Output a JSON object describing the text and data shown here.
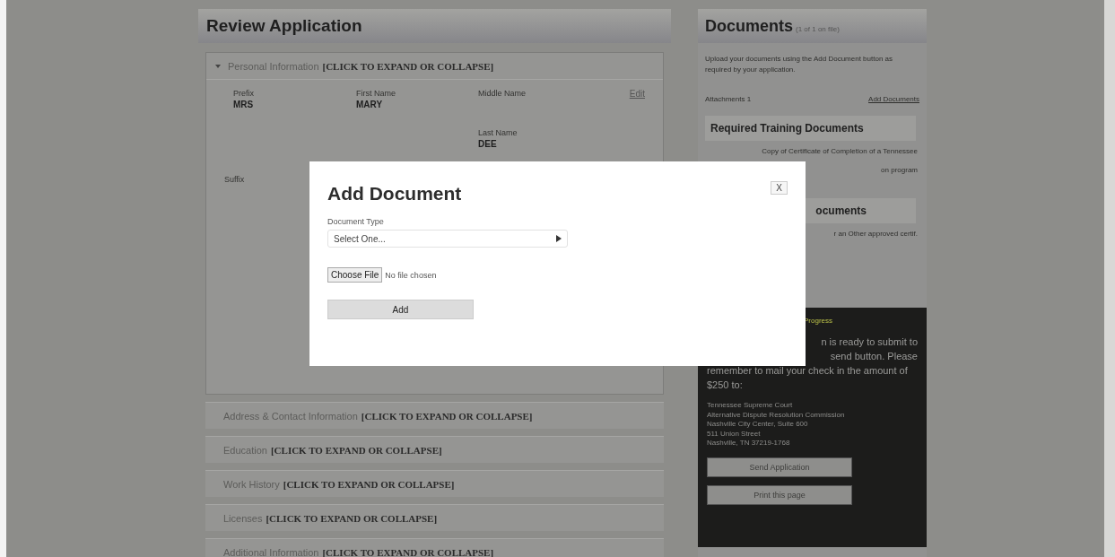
{
  "main": {
    "title": "Review Application",
    "sections": [
      {
        "title": "Personal Information",
        "action": "[CLICK TO EXPAND OR COLLAPSE]",
        "expanded": true,
        "edit": "Edit",
        "fields": [
          {
            "label": "Prefix",
            "value": "MRS"
          },
          {
            "label": "First Name",
            "value": "MARY"
          },
          {
            "label": "Middle Name"
          },
          {
            "label": "Last Name",
            "value": "DEE"
          },
          {
            "label": "Suffix"
          }
        ]
      },
      {
        "title": "Address & Contact Information",
        "action": "[CLICK TO EXPAND OR COLLAPSE]",
        "expanded": false
      },
      {
        "title": "Education",
        "action": "[CLICK TO EXPAND OR COLLAPSE]",
        "expanded": false
      },
      {
        "title": "Work History",
        "action": "[CLICK TO EXPAND OR COLLAPSE]",
        "expanded": false
      },
      {
        "title": "Licenses",
        "action": "[CLICK TO EXPAND OR COLLAPSE]",
        "expanded": false
      },
      {
        "title": "Additional Information",
        "action": "[CLICK TO EXPAND OR COLLAPSE]",
        "expanded": false
      }
    ]
  },
  "documents": {
    "title": "Documents",
    "subtitle": "(1 of 1 on file)",
    "intro": "Upload your documents using the Add Document button as required by your application.",
    "count": "Attachments 1",
    "add_link": "Add Documents",
    "groups": [
      {
        "title": "Required Training Documents",
        "lines": [
          "Copy of Certificate of Completion of a Tennessee",
          "on program"
        ]
      },
      {
        "title": "ocuments",
        "lines": [
          "r an Other approved certif."
        ]
      }
    ]
  },
  "submit_panel": {
    "title": "Progress",
    "lines": [
      "n is ready to submit to",
      "send button. Please"
    ],
    "message": "remember to mail your check in the amount of $250 to:",
    "address": [
      "Tennessee Supreme Court",
      "Alternative Dispute Resolution Commission",
      "Nashville City Center, Suite 600",
      "511 Union Street",
      "Nashville, TN 37219-1768"
    ],
    "buttons": [
      "Send Application",
      "Print this page"
    ]
  },
  "dialog": {
    "title": "Add Document",
    "close": "X",
    "type_label": "Document Type",
    "type_value": "Select One...",
    "file_button": "Choose File",
    "file_status": "No file chosen",
    "submit": "Add"
  }
}
